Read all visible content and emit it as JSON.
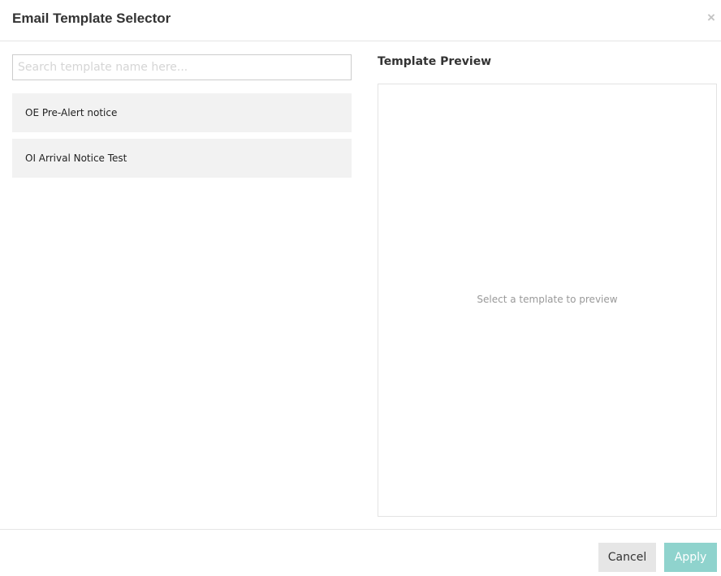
{
  "header": {
    "title": "Email Template Selector",
    "close_label": "×"
  },
  "search": {
    "value": "",
    "placeholder": "Search template name here..."
  },
  "templates": [
    {
      "label": "OE Pre-Alert notice"
    },
    {
      "label": "OI Arrival Notice Test"
    }
  ],
  "preview": {
    "title": "Template Preview",
    "empty_message": "Select a template to preview"
  },
  "footer": {
    "cancel_label": "Cancel",
    "apply_label": "Apply"
  },
  "colors": {
    "apply_disabled": "#8fd3cd",
    "cancel_bg": "#e6e6e6",
    "list_item_bg": "#f2f2f2"
  }
}
